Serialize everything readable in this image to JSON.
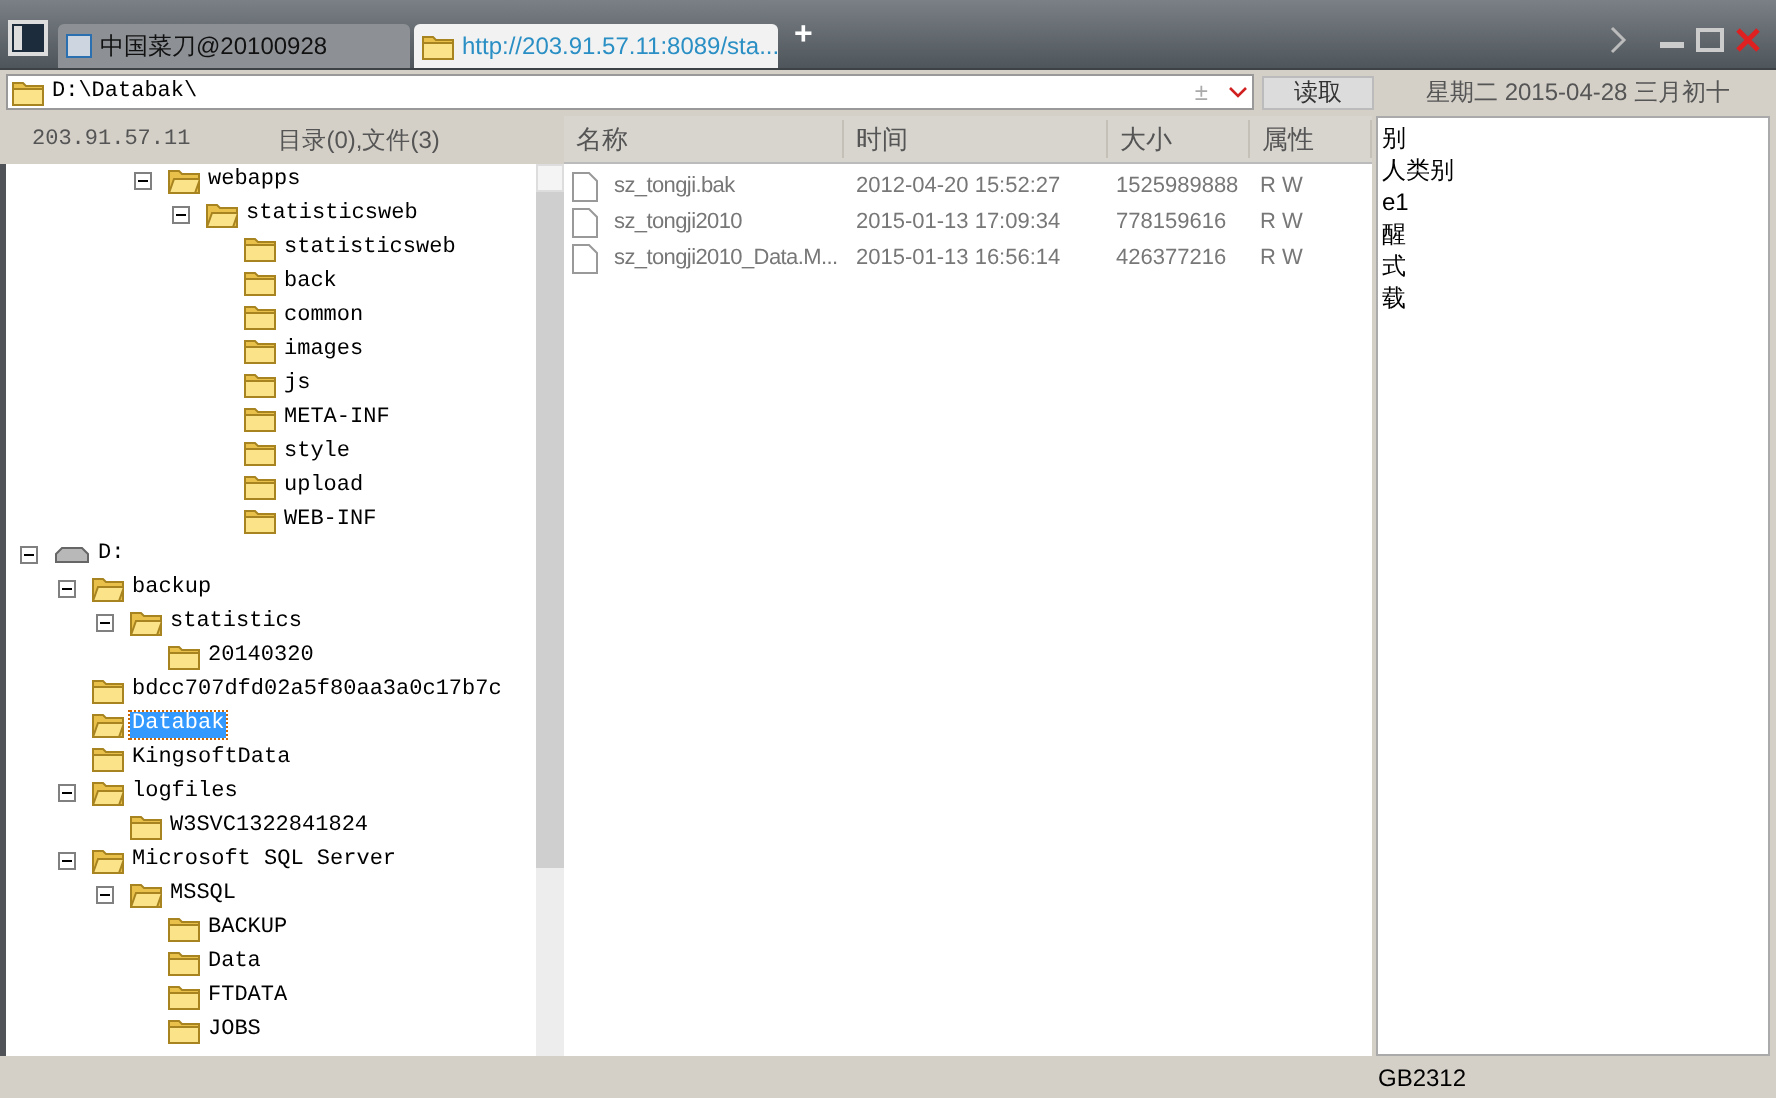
{
  "tabs": [
    {
      "label": "中国菜刀@20100928",
      "selected": false
    },
    {
      "label": "http://203.91.57.11:8089/sta...",
      "selected": true
    }
  ],
  "new_tab": "+",
  "address_bar": {
    "value": "D:\\Databak\\",
    "toggle": "±"
  },
  "read_button": "读取",
  "date": "星期二 2015-04-28 三月初十",
  "server": "203.91.57.11",
  "summary": "目录(0),文件(3)",
  "scrolled_branch": [
    {
      "label": "webapps",
      "expanded": true,
      "selected": false,
      "children": [
        {
          "label": "statisticsweb",
          "expanded": true,
          "selected": false,
          "children": [
            {
              "label": "statisticsweb",
              "selected": false
            },
            {
              "label": "back",
              "selected": false
            },
            {
              "label": "common",
              "selected": false
            },
            {
              "label": "images",
              "selected": false
            },
            {
              "label": "js",
              "selected": false
            },
            {
              "label": "META-INF",
              "selected": false
            },
            {
              "label": "style",
              "selected": false
            },
            {
              "label": "upload",
              "selected": false
            },
            {
              "label": "WEB-INF",
              "selected": false
            }
          ]
        }
      ]
    }
  ],
  "tree": [
    {
      "label": "D:",
      "kind": "drive",
      "expanded": true,
      "selected": false,
      "children": [
        {
          "label": "backup",
          "expanded": true,
          "selected": false,
          "children": [
            {
              "label": "statistics",
              "expanded": true,
              "selected": false,
              "children": [
                {
                  "label": "20140320",
                  "selected": false
                }
              ]
            }
          ]
        },
        {
          "label": "bdcc707dfd02a5f80aa3a0c17b7c",
          "selected": false
        },
        {
          "label": "Databak",
          "selected": true
        },
        {
          "label": "KingsoftData",
          "selected": false
        },
        {
          "label": "logfiles",
          "expanded": true,
          "selected": false,
          "children": [
            {
              "label": "W3SVC1322841824",
              "selected": false
            }
          ]
        },
        {
          "label": "Microsoft SQL Server",
          "expanded": true,
          "selected": false,
          "children": [
            {
              "label": "MSSQL",
              "expanded": true,
              "selected": false,
              "children": [
                {
                  "label": "BACKUP",
                  "selected": false
                },
                {
                  "label": "Data",
                  "selected": false
                },
                {
                  "label": "FTDATA",
                  "selected": false
                },
                {
                  "label": "JOBS",
                  "selected": false
                }
              ]
            }
          ]
        }
      ]
    }
  ],
  "table": {
    "columns": [
      "名称",
      "时间",
      "大小",
      "属性"
    ],
    "rows": [
      [
        "sz_tongji.bak",
        "2012-04-20 15:52:27",
        "1525989888",
        "R W"
      ],
      [
        "sz_tongji2010",
        "2015-01-13 17:09:34",
        "778159616",
        "R W"
      ],
      [
        "sz_tongji2010_Data.M...",
        "2015-01-13 16:56:14",
        "426377216",
        "R W"
      ]
    ]
  },
  "notes": [
    "别",
    "人类别",
    "e1",
    "醒",
    "式",
    "载"
  ],
  "status_bar": {
    "encoding": "GB2312"
  }
}
